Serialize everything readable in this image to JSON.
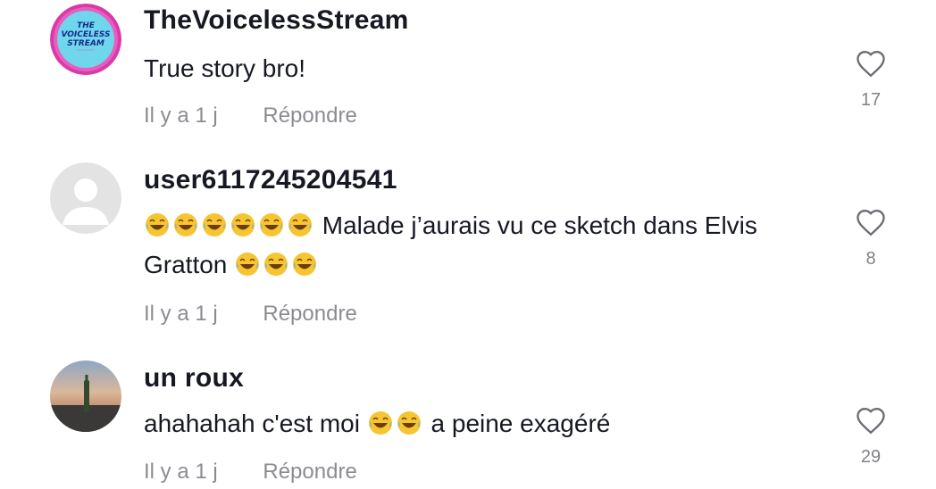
{
  "comments": [
    {
      "username": "TheVoicelessStream",
      "avatar_text": [
        "THE",
        "VOICELESS",
        "STREAM"
      ],
      "text": "True story bro!",
      "time": "Il y a 1 j",
      "reply_label": "Répondre",
      "likes": "17"
    },
    {
      "username": "user6117245204541",
      "text_part1": "Malade j’aurais vu ce sketch dans Elvis",
      "text_part2": "Gratton",
      "time": "Il y a 1 j",
      "reply_label": "Répondre",
      "likes": "8"
    },
    {
      "username": "un roux",
      "text_before": "ahahahah c'est moi",
      "text_after": "a peine exagéré",
      "time": "Il y a 1 j",
      "reply_label": "Répondre",
      "likes": "29"
    }
  ],
  "icons": {
    "like": "heart-outline-icon",
    "emoji": "face-with-tears-of-joy"
  }
}
